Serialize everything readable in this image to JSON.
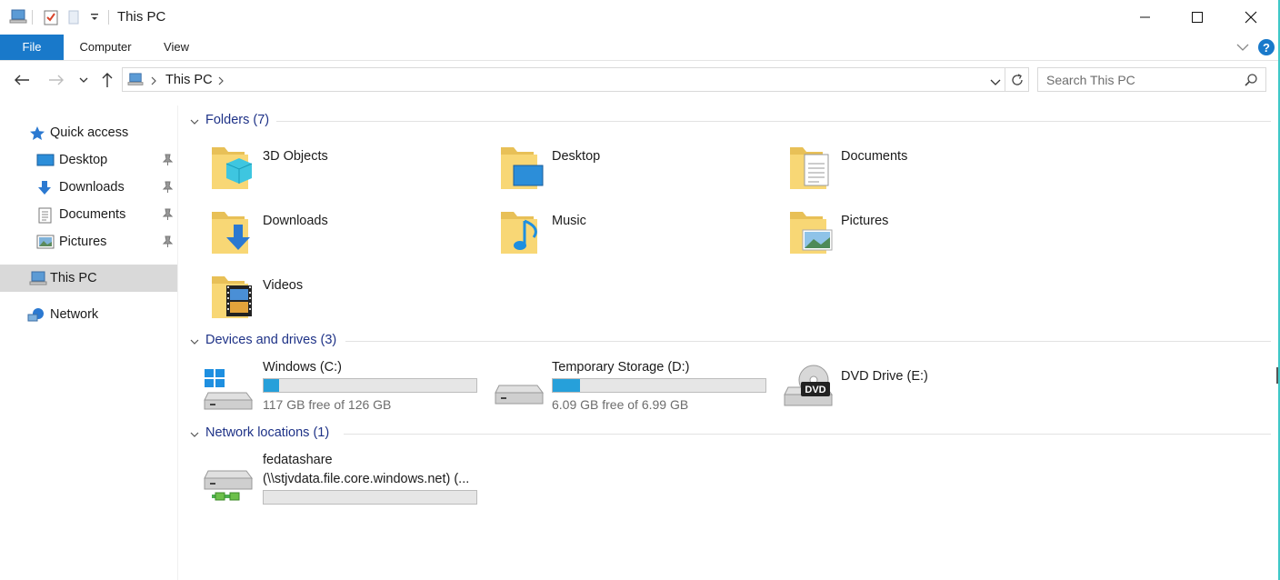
{
  "window": {
    "title": "This PC"
  },
  "ribbon": {
    "tabs": [
      {
        "label": "File"
      },
      {
        "label": "Computer"
      },
      {
        "label": "View"
      }
    ]
  },
  "address": {
    "segments": [
      "This PC"
    ]
  },
  "search": {
    "placeholder": "Search This PC"
  },
  "sidebar": {
    "quick_access": "Quick access",
    "pinned": [
      {
        "label": "Desktop"
      },
      {
        "label": "Downloads"
      },
      {
        "label": "Documents"
      },
      {
        "label": "Pictures"
      }
    ],
    "this_pc": "This PC",
    "network": "Network"
  },
  "groups": {
    "folders": {
      "header": "Folders (7)",
      "items": [
        "3D Objects",
        "Desktop",
        "Documents",
        "Downloads",
        "Music",
        "Pictures",
        "Videos"
      ]
    },
    "devices": {
      "header": "Devices and drives (3)",
      "items": [
        {
          "name": "Windows (C:)",
          "free": "117 GB free of 126 GB",
          "used_fraction": 0.071
        },
        {
          "name": "Temporary Storage (D:)",
          "free": "6.09 GB free of 6.99 GB",
          "used_fraction": 0.129
        },
        {
          "name": "DVD Drive (E:)",
          "badge": "DVD"
        }
      ]
    },
    "network": {
      "header": "Network locations (1)",
      "items": [
        {
          "name": "fedatashare",
          "path": "(\\\\stjvdata.file.core.windows.net) (..."
        }
      ]
    }
  },
  "colors": {
    "accent": "#1979ca",
    "drive_bar": "#26a0da",
    "group_header": "#1e3287",
    "folder": "#f8d775"
  }
}
